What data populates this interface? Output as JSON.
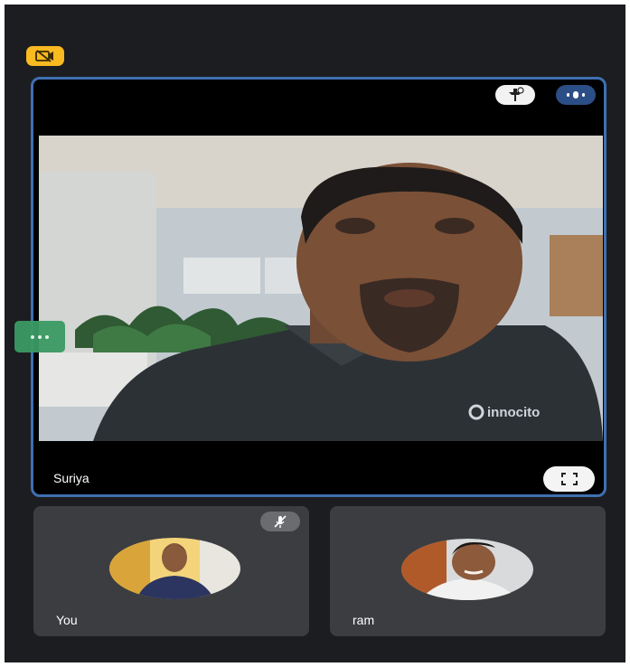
{
  "participants": {
    "main": {
      "name": "Suriya",
      "shirt_logo": "innocito"
    },
    "tiles": [
      {
        "name": "You",
        "muted": true
      },
      {
        "name": "ram",
        "muted": false
      }
    ]
  },
  "colors": {
    "background": "#1c1d21",
    "active_border": "#3f6fb0",
    "recording_badge": "#f9ba22",
    "tile": "#3c3d41"
  },
  "icons": {
    "recording": "camera-off-icon",
    "pin": "pin-icon",
    "more": "more-options-icon",
    "fullscreen": "fullscreen-icon",
    "mic_off": "mic-off-icon",
    "side_panel": "more-horizontal-icon"
  }
}
